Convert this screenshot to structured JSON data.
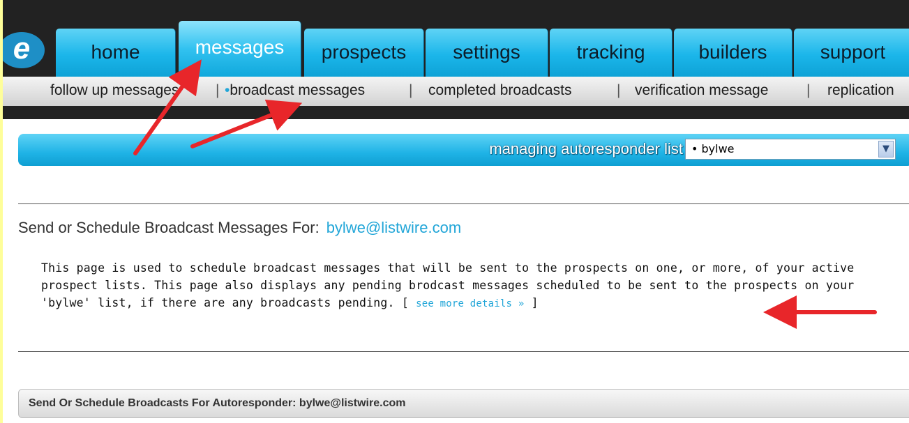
{
  "logo": {
    "glyph": "e"
  },
  "nav": {
    "tabs": [
      {
        "label": "home"
      },
      {
        "label": "messages"
      },
      {
        "label": "prospects"
      },
      {
        "label": "settings"
      },
      {
        "label": "tracking"
      },
      {
        "label": "builders"
      },
      {
        "label": "support"
      }
    ],
    "active_tab": "messages"
  },
  "subnav": {
    "items": [
      {
        "label": "follow up messages"
      },
      {
        "label": "broadcast messages"
      },
      {
        "label": "completed broadcasts"
      },
      {
        "label": "verification message"
      },
      {
        "label": "replication"
      }
    ],
    "separator": "|",
    "active_bullet": "•"
  },
  "list_selector": {
    "label": "managing autoresponder list",
    "selected": "• bylwe",
    "arrow": "▼"
  },
  "section": {
    "title": "Send or Schedule Broadcast Messages For:",
    "email": "bylwe@listwire.com",
    "description": "This page is used to schedule broadcast messages that will be sent to the prospects on one, or more, of your active prospect lists. This page also displays any pending brodcast messages scheduled to be sent to the prospects on your 'bylwe' list, if there are any broadcasts pending.",
    "more_open": "[",
    "more_link": "see more details »",
    "more_close": "]"
  },
  "bottom_bar": {
    "title": "Send Or Schedule Broadcasts For Autoresponder: bylwe@listwire.com"
  },
  "colors": {
    "accent": "#22a6d8",
    "tab_blue": "#1bb6ea",
    "annotation_red": "#e8262a",
    "page_bg": "#fefe9a"
  }
}
